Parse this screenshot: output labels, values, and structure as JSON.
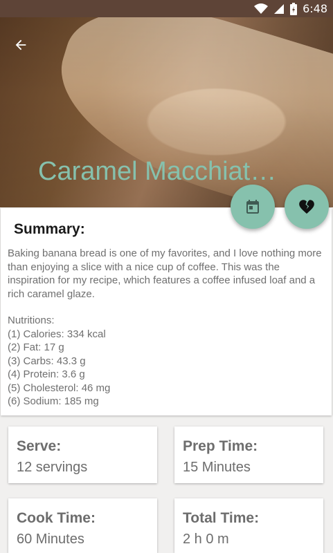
{
  "status_bar": {
    "time": "6:48"
  },
  "header": {
    "title": "Caramel Macchiato Banana Bread"
  },
  "actions": {
    "calendar_icon": "calendar-icon",
    "favorite_icon": "broken-heart-icon",
    "accent_color": "#86c1ad"
  },
  "summary": {
    "heading": "Summary:",
    "description": "Baking banana bread is one of my favorites, and I love nothing more than enjoying a slice with a nice cup of coffee. This was the inspiration for my recipe, which features a coffee infused loaf and a rich caramel glaze.",
    "nutrition_heading": "Nutritions:",
    "nutrition": [
      "(1) Calories: 334 kcal",
      "(2) Fat: 17 g",
      "(3) Carbs: 43.3 g",
      "(4) Protein: 3.6 g",
      "(5) Cholesterol: 46 mg",
      "(6) Sodium: 185 mg"
    ]
  },
  "info_cards": [
    {
      "label": "Serve:",
      "value": "12 servings"
    },
    {
      "label": "Prep Time:",
      "value": "15 Minutes"
    },
    {
      "label": "Cook Time:",
      "value": "60 Minutes"
    },
    {
      "label": "Total Time:",
      "value": "2 h 0 m"
    }
  ]
}
